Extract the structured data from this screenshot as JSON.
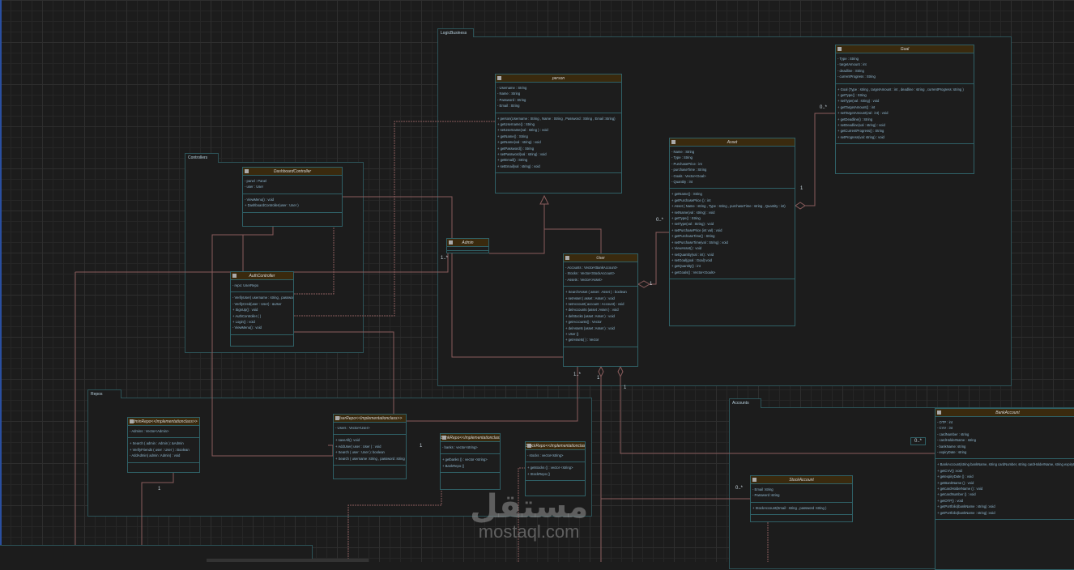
{
  "packages": {
    "logic": "LogicBusiness",
    "controllers": "Controllers",
    "repos": "Repos",
    "accounts": "Accounts"
  },
  "classes": {
    "person": {
      "name": "person",
      "attributes": [
        "- Username : String",
        "- Name : String",
        "- Password : String",
        "- Email : String"
      ],
      "methods": [
        "+ person(Username : String , Name : String , Password : String , Email :String)",
        "+ getUsername() : String",
        "+ setUsername(val : string ) : void",
        "+ getName() : String",
        "+ getName(val : string) : void",
        "+ getPassword() : String",
        "+ setPassword(val : string) : void",
        "+ getEmail() : String",
        "+ setEmail(val : string) : void"
      ]
    },
    "goal": {
      "name": "Goal",
      "attributes": [
        "- Type : String",
        "- targetAmount : int",
        "- deadline : String",
        "- currentProgress : String"
      ],
      "methods": [
        "+ Goal (Type : string , targetAmount : int , deadline : string , currentProgress :string )",
        "+ getType() : String",
        "+ setType(val : string) : void",
        "+ getTargetAmount() : int",
        "+ setTargetAmount(val : int) : void",
        "+ getDeadline() : String",
        "+ setDeadline(val : string) : void",
        "+ getCurrentProgress() : String",
        "+ setProgress(val: string) : void"
      ]
    },
    "asset": {
      "name": "Asset",
      "attributes": [
        "- Name : String",
        "- Type : String",
        "- PurchasePrice : int",
        "- purchaseTime : String",
        "- Goals : Vector<Goal>",
        "- Quantity : int"
      ],
      "methods": [
        "+ getName() : String",
        "+ getPurchasePrice () : int",
        "+ Asset ( Name : string , Type : string , purchaseTime : string , Quantity : int)",
        "+ setName(val : string) : void",
        "+ getType() : String",
        "+ setType(val : String) : void",
        "+ setPurchasePrice (int val) : void",
        "+ getPurchaseTime() : String",
        "+ setPurchaseTime(val : String) : void",
        "+ ViewAsset() : void",
        "+ setQuantity(val : int) : void",
        "+ setGoal(goal : Goal):void",
        "+ getQuantity() : int",
        "+ getGoals() : Vector<Goals>"
      ]
    },
    "user": {
      "name": "User",
      "attributes": [
        "- Accounts : Vector<BankAccount>",
        "- Stocks : Vector<StockAccount>",
        "- Assets : Vector<Asset>"
      ],
      "methods": [
        "+ SearchAsset ( asset : Asset ) : boolean",
        "+ setAsset ( asset : Asset ) : void",
        "+ setAccount( account : Account) : void",
        "+ delAccounts (asset :Asset ) : void",
        "+ delStocks (asset :Asset ) : void",
        "+ getAccounts() : Vector",
        "+ delAssets (asset :Asset ) : void",
        "+ User ()",
        "+ getAssets( ) : Vector"
      ]
    },
    "admin": {
      "name": "Admin",
      "attributes": [],
      "methods": []
    },
    "dashboard": {
      "name": "DashboardController",
      "attributes": [
        "- panel : Panel",
        "- user : User"
      ],
      "methods": [
        "- ViewMenu() : void",
        "+ DashboardController(user : User )"
      ]
    },
    "auth": {
      "name": "AuthController",
      "attributes": [
        "- repo: UserRepo"
      ],
      "methods": [
        "- VerifyUser( username : string , password :string) : &User",
        "- VerifyCred(user : User) : &User",
        "+ SignUp() : void",
        "+ AuthController ( )",
        "+ Login() : void",
        "- ViewMenu() : void"
      ]
    },
    "adminrepo": {
      "name": "AdminRepo<<Implementationclass>>",
      "attributes": [
        "- Admins : Vector<Admin>"
      ],
      "methods": [
        "+ Search ( admin : Admin ): &Admin",
        "+ VerifyFriends ( user : User ) : Boolean",
        "- AddAdmin( admin :Admin) : void"
      ]
    },
    "userrepo": {
      "name": "UserRepo<<Implementationclass>>",
      "attributes": [
        "- Users : Vector<User>"
      ],
      "methods": [
        "+ saveAll(): void",
        "+ AddUser( user : User ) : void",
        "+ Search ( user : User ): boolean",
        "+ Search ( username :string , password :string ): &User"
      ]
    },
    "bankrepo": {
      "name": "BankRepo<<Implementationclass>>",
      "attributes": [
        "- banks : vector<string>"
      ],
      "methods": [
        "+ getbanks () : vector <string>",
        "+ BankRepo ()"
      ]
    },
    "stockrepo": {
      "name": "StockRepo<<Implementationclass>>",
      "attributes": [
        "- stocks : vector<string>"
      ],
      "methods": [
        "+ getstocks () : vector <string>",
        "+ StockRepo ()"
      ]
    },
    "stockaccount": {
      "name": "StockAccount",
      "attributes": [
        "- Email :string",
        "- Password :string"
      ],
      "methods": [
        "+ StockAccount(Email : string , password :string )"
      ]
    },
    "bankaccount": {
      "name": "BankAccount",
      "attributes": [
        "- OTP : int",
        "- CVV : int",
        "- cardNumber : string",
        "- cardHolderName : string",
        "- bankName: string",
        "- expiryDate : string"
      ],
      "methods": [
        "+ BankAccount(string bankName, string cardNumber, string cardHolderName, string expiryDate, int otp, int cvv)",
        "+ getCVV() :void",
        "+ getexpiryDate () : void",
        "+ getBankName () : void",
        "+ getcardHolderName () : void",
        "+ getcardNumber () : void",
        "+ getOTP() : void",
        "+ getPortfolio(bankName : string) :void",
        "+ getPortfolio(bankName : string) :void"
      ]
    }
  },
  "multiplicities": [
    "0..*",
    "1",
    "0..*",
    "1",
    "1..*",
    "1..*",
    "1",
    "1",
    "1",
    "1",
    "0..*",
    "0..*"
  ],
  "watermark": {
    "arabic": "مستقل",
    "latin": "mostaql.com"
  },
  "colors": {
    "background": "#1c1c1c",
    "classHeader": "#3a2a0e",
    "border": "#2f6066",
    "connector": "#8a5c5c"
  }
}
